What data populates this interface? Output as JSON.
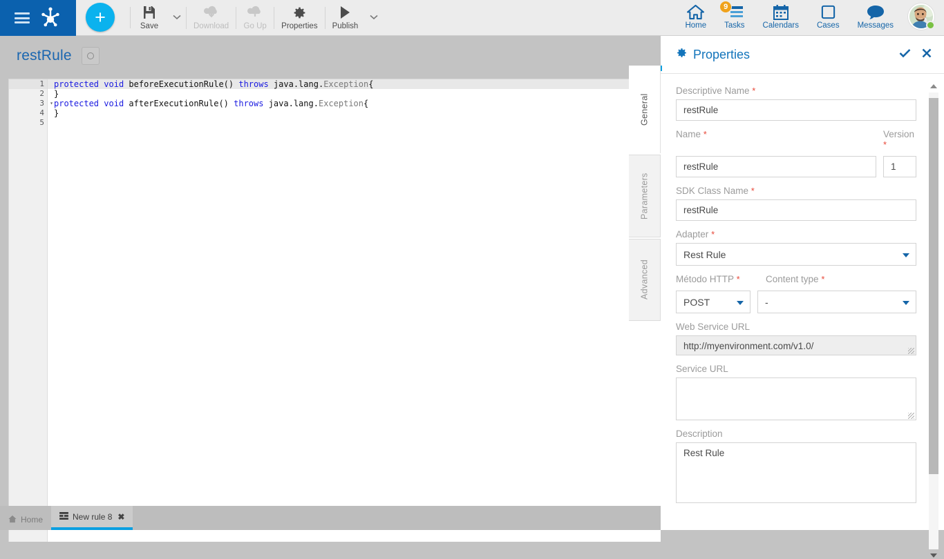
{
  "brand": {
    "menu_icon": "hamburger-icon",
    "logo_icon": "frogfoot-logo-icon",
    "add_label": "+"
  },
  "toolbar": {
    "items": [
      {
        "label": "Save",
        "icon": "save-floppy-icon",
        "disabled": false
      },
      {
        "label": "Download",
        "icon": "download-cloud-icon",
        "disabled": true
      },
      {
        "label": "Go Up",
        "icon": "upload-cloud-icon",
        "disabled": true
      },
      {
        "label": "Properties",
        "icon": "gear-icon",
        "disabled": false
      },
      {
        "label": "Publish",
        "icon": "play-triangle-icon",
        "disabled": false
      }
    ],
    "caret_icon": "chevron-down-icon"
  },
  "topnav": {
    "items": [
      {
        "label": "Home",
        "icon": "home-icon",
        "badge": ""
      },
      {
        "label": "Tasks",
        "icon": "tasks-list-icon",
        "badge": "9"
      },
      {
        "label": "Calendars",
        "icon": "calendar-icon",
        "badge": ""
      },
      {
        "label": "Cases",
        "icon": "case-square-icon",
        "badge": ""
      },
      {
        "label": "Messages",
        "icon": "speech-bubble-icon",
        "badge": ""
      }
    ],
    "avatar_status": "online"
  },
  "workspace": {
    "rule_title": "restRule",
    "status_icon": "circle-outline-icon"
  },
  "editor": {
    "lines": [
      {
        "n": "1",
        "fold": true,
        "active": true,
        "tokens": [
          {
            "t": "protected",
            "c": "kw"
          },
          {
            "t": " ",
            "c": ""
          },
          {
            "t": "void",
            "c": "kw"
          },
          {
            "t": " beforeExecutionRule() ",
            "c": ""
          },
          {
            "t": "throws",
            "c": "kw"
          },
          {
            "t": " java.lang.",
            "c": ""
          },
          {
            "t": "Exception",
            "c": "cls"
          },
          {
            "t": "{",
            "c": ""
          }
        ]
      },
      {
        "n": "2",
        "fold": false,
        "active": false,
        "tokens": [
          {
            "t": "}",
            "c": ""
          }
        ]
      },
      {
        "n": "3",
        "fold": true,
        "active": false,
        "tokens": [
          {
            "t": "protected",
            "c": "kw"
          },
          {
            "t": " ",
            "c": ""
          },
          {
            "t": "void",
            "c": "kw"
          },
          {
            "t": " afterExecutionRule() ",
            "c": ""
          },
          {
            "t": "throws",
            "c": "kw"
          },
          {
            "t": " java.lang.",
            "c": ""
          },
          {
            "t": "Exception",
            "c": "cls"
          },
          {
            "t": "{",
            "c": ""
          }
        ]
      },
      {
        "n": "4",
        "fold": false,
        "active": false,
        "tokens": [
          {
            "t": "}",
            "c": ""
          }
        ]
      },
      {
        "n": "5",
        "fold": false,
        "active": false,
        "tokens": []
      }
    ]
  },
  "properties": {
    "title": "Properties",
    "title_icon": "gear-icon",
    "confirm_icon": "check-icon",
    "close_icon": "close-x-icon",
    "tabs": [
      {
        "label": "General",
        "active": true
      },
      {
        "label": "Parameters",
        "active": false
      },
      {
        "label": "Advanced",
        "active": false
      }
    ],
    "fields": {
      "descriptive_name_label": "Descriptive Name",
      "descriptive_name_value": "restRule",
      "name_label": "Name",
      "name_value": "restRule",
      "version_label": "Version",
      "version_value": "1",
      "sdk_class_label": "SDK Class Name",
      "sdk_class_value": "restRule",
      "adapter_label": "Adapter",
      "adapter_value": "Rest Rule",
      "http_method_label": "Método HTTP",
      "http_method_value": "POST",
      "content_type_label": "Content type",
      "content_type_value": "-",
      "web_service_url_label": "Web Service URL",
      "web_service_url_value": "http://myenvironment.com/v1.0/",
      "service_url_label": "Service URL",
      "service_url_value": "",
      "description_label": "Description",
      "description_value": "Rest Rule",
      "required_marker": "*"
    }
  },
  "bottom_tabs": [
    {
      "label": "Home",
      "icon": "home-small-icon",
      "active": false,
      "closable": false
    },
    {
      "label": "New rule 8",
      "icon": "rule-small-icon",
      "active": true,
      "closable": true,
      "close_icon": "close-x-icon"
    }
  ],
  "colors": {
    "brand_blue": "#0b61ae",
    "accent_cyan": "#0bb2ee",
    "link_blue": "#1565a8",
    "badge_orange": "#f0a21b",
    "status_green": "#7ac143",
    "required_red": "#e8493a"
  }
}
